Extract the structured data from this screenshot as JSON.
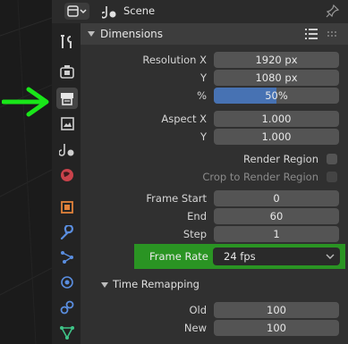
{
  "header": {
    "scene_label": "Scene"
  },
  "tabs": [
    {
      "name": "tool",
      "active": false
    },
    {
      "name": "render",
      "active": false
    },
    {
      "name": "output",
      "active": true
    },
    {
      "name": "view-layer",
      "active": false
    },
    {
      "name": "scene",
      "active": false
    },
    {
      "name": "world",
      "active": false
    },
    {
      "name": "object",
      "active": false
    },
    {
      "name": "modifiers",
      "active": false
    },
    {
      "name": "particles",
      "active": false
    },
    {
      "name": "physics",
      "active": false
    },
    {
      "name": "constraints",
      "active": false
    },
    {
      "name": "data",
      "active": false
    }
  ],
  "dimensions": {
    "title": "Dimensions",
    "resolution_x_label": "Resolution X",
    "resolution_x_value": "1920 px",
    "resolution_y_label": "Y",
    "resolution_y_value": "1080 px",
    "percent_label": "%",
    "percent_value": "50%",
    "percent_fraction": 0.5,
    "aspect_x_label": "Aspect X",
    "aspect_x_value": "1.000",
    "aspect_y_label": "Y",
    "aspect_y_value": "1.000",
    "render_region_label": "Render Region",
    "render_region_checked": false,
    "crop_label": "Crop to Render Region",
    "crop_checked": false,
    "frame_start_label": "Frame Start",
    "frame_start_value": "0",
    "frame_end_label": "End",
    "frame_end_value": "60",
    "frame_step_label": "Step",
    "frame_step_value": "1",
    "frame_rate_label": "Frame Rate",
    "frame_rate_value": "24 fps"
  },
  "time_remapping": {
    "title": "Time Remapping",
    "old_label": "Old",
    "old_value": "100",
    "new_label": "New",
    "new_value": "100"
  },
  "colors": {
    "highlight": "#2a9423",
    "progress": "#4772b3",
    "annotation_arrow": "#19e619"
  }
}
